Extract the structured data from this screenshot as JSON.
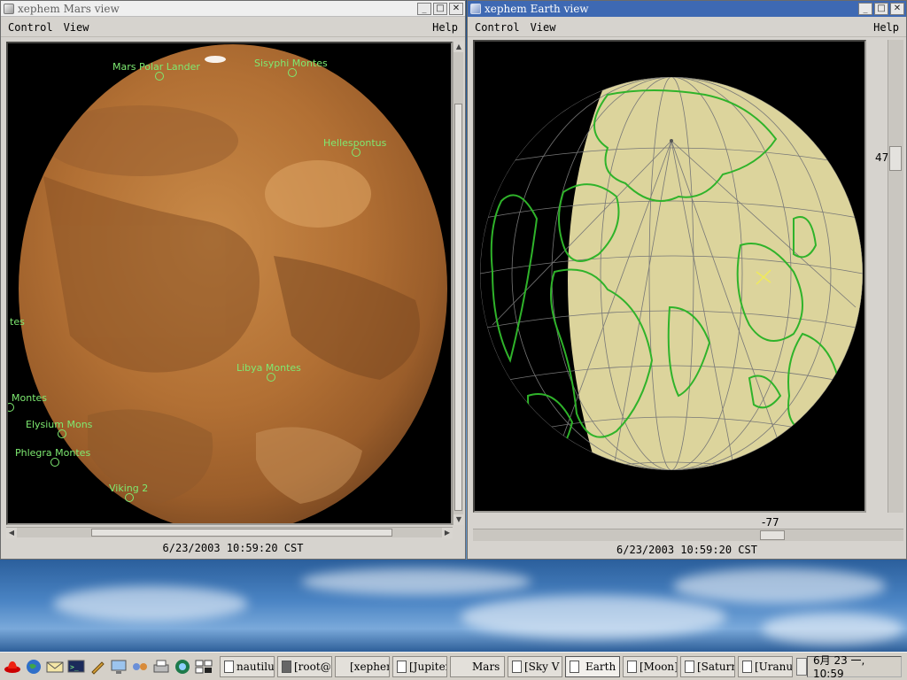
{
  "mars_window": {
    "title": "xephem  Mars  view",
    "menu": {
      "control": "Control",
      "view": "View",
      "help": "Help"
    },
    "status": "6/23/2003  10:59:20  CST",
    "features": [
      {
        "name": "Mars Polar Lander"
      },
      {
        "name": "Sisyphi Montes"
      },
      {
        "name": "Hellespontus"
      },
      {
        "name": "tes"
      },
      {
        "name": "Libya Montes"
      },
      {
        "name": "Montes"
      },
      {
        "name": "Elysium Mons"
      },
      {
        "name": "Phlegra Montes"
      },
      {
        "name": "Viking 2"
      }
    ]
  },
  "earth_window": {
    "title": "xephem  Earth  view",
    "menu": {
      "control": "Control",
      "view": "View",
      "help": "Help"
    },
    "status": "6/23/2003  10:59:20  CST",
    "latitude_label": "47",
    "longitude_label": "-77"
  },
  "taskbar": {
    "launchers": [
      "redhat-icon",
      "globe-icon",
      "mail-icon",
      "terminal-icon",
      "edit-icon",
      "monitor-icon",
      "network-icon",
      "printer-icon",
      "web-icon",
      "apps-icon"
    ],
    "tasks": [
      {
        "label": "nautilus",
        "active": false
      },
      {
        "label": "[root@lo",
        "active": false
      },
      {
        "label": "[xephen",
        "active": false
      },
      {
        "label": "[Jupiter",
        "active": false
      },
      {
        "label": "Mars",
        "active": false
      },
      {
        "label": "[Sky  V",
        "active": false
      },
      {
        "label": "Earth",
        "active": true
      },
      {
        "label": "[Moon]",
        "active": false
      },
      {
        "label": "[Saturn]",
        "active": false
      },
      {
        "label": "[Uranus",
        "active": false
      }
    ],
    "clock": "6月  23  一, 10:59"
  },
  "colors": {
    "title_active": "#3e69b3",
    "label_green": "#7eea71",
    "mars_surface": "#b9783a",
    "earth_land": "#dcd49c",
    "coastline": "#2fb32a"
  }
}
